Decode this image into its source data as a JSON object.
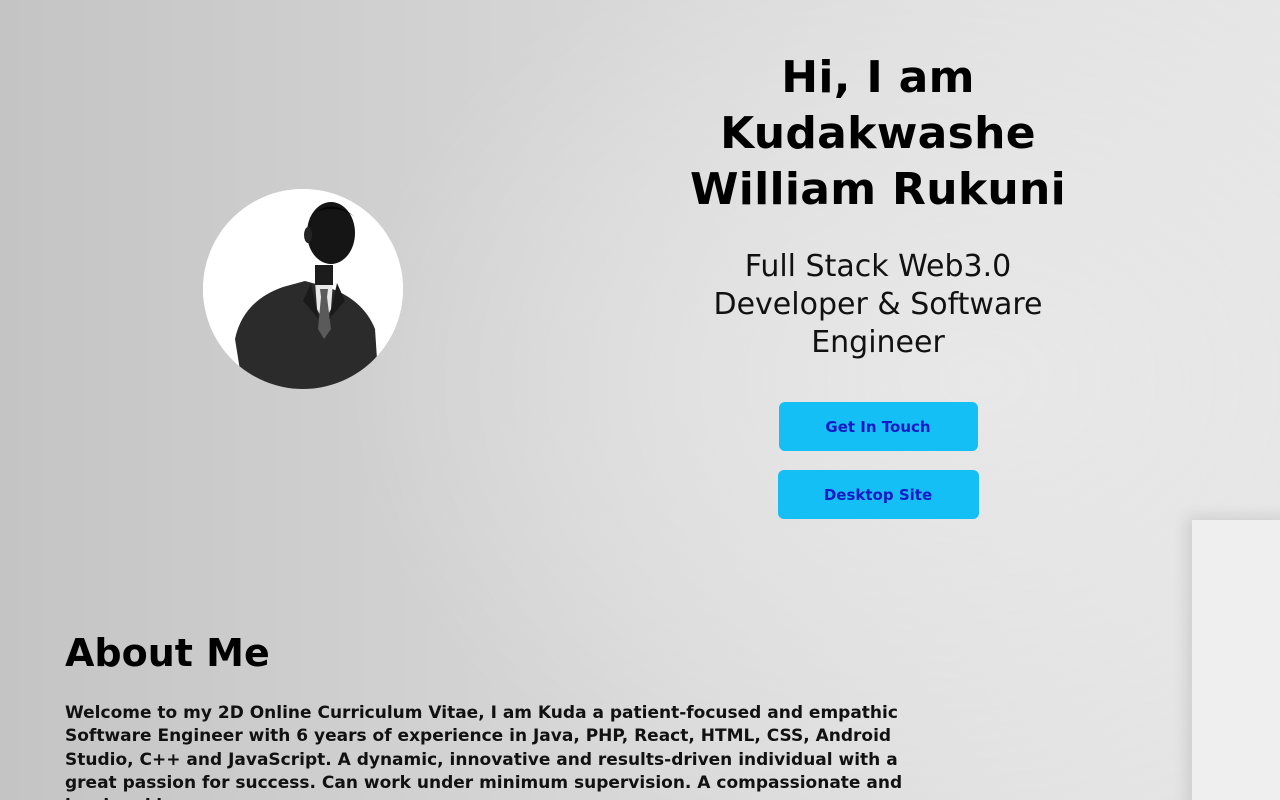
{
  "hero": {
    "greeting": "Hi, I am Kudakwashe William Rukuni",
    "subtitle": "Full Stack Web3.0 Developer & Software Engineer",
    "contact_button": "Get In Touch",
    "desktop_button": "Desktop Site"
  },
  "profile": {
    "photo_alt": "Profile photo"
  },
  "about": {
    "heading": "About Me",
    "body": "Welcome to my 2D Online Curriculum Vitae, I am Kuda a patient-focused and empathic Software Engineer with 6 years of experience in Java, PHP, React, HTML, CSS, Android Studio, C++ and JavaScript. A dynamic, innovative and results-driven individual with a great passion for success. Can work under minimum supervision. A compassionate and hardworking"
  },
  "colors": {
    "button_bg": "#14bff5",
    "button_text": "#1418c8",
    "heading_text": "#000000"
  }
}
